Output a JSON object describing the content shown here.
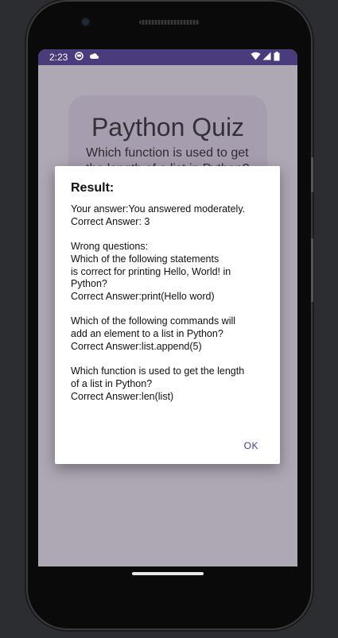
{
  "statusbar": {
    "time": "2:23",
    "left_icons": [
      "notification-icon",
      "cloud-icon"
    ],
    "right_icons": [
      "wifi-icon",
      "signal-icon",
      "battery-icon"
    ],
    "color": "#4a3b7c"
  },
  "quiz": {
    "title": "Paython Quiz",
    "question": "Which function is used to get the length of a list in Python?"
  },
  "dialog": {
    "title": "Result:",
    "your_answer": "Your answer:You answered moderately.",
    "correct_answer_count": "Correct Answer: 3",
    "wrong_questions_heading": "Wrong questions:",
    "q1_line1": "Which of the following statements",
    "q1_line2": "is correct for printing Hello, World! in",
    "q1_line3": "Python?",
    "q1_answer": "Correct Answer:print(Hello word)",
    "q2_line1": "Which of the following commands will",
    "q2_line2": "add an element to a list in Python?",
    "q2_answer": "Correct Answer:list.append(5)",
    "q3_line1": "Which function is used to get the length",
    "q3_line2": "of a list in Python?",
    "q3_answer": "Correct Answer:len(list)",
    "ok_label": "OK"
  },
  "colors": {
    "accent": "#4a3b7c",
    "background": "#2c2d30"
  }
}
